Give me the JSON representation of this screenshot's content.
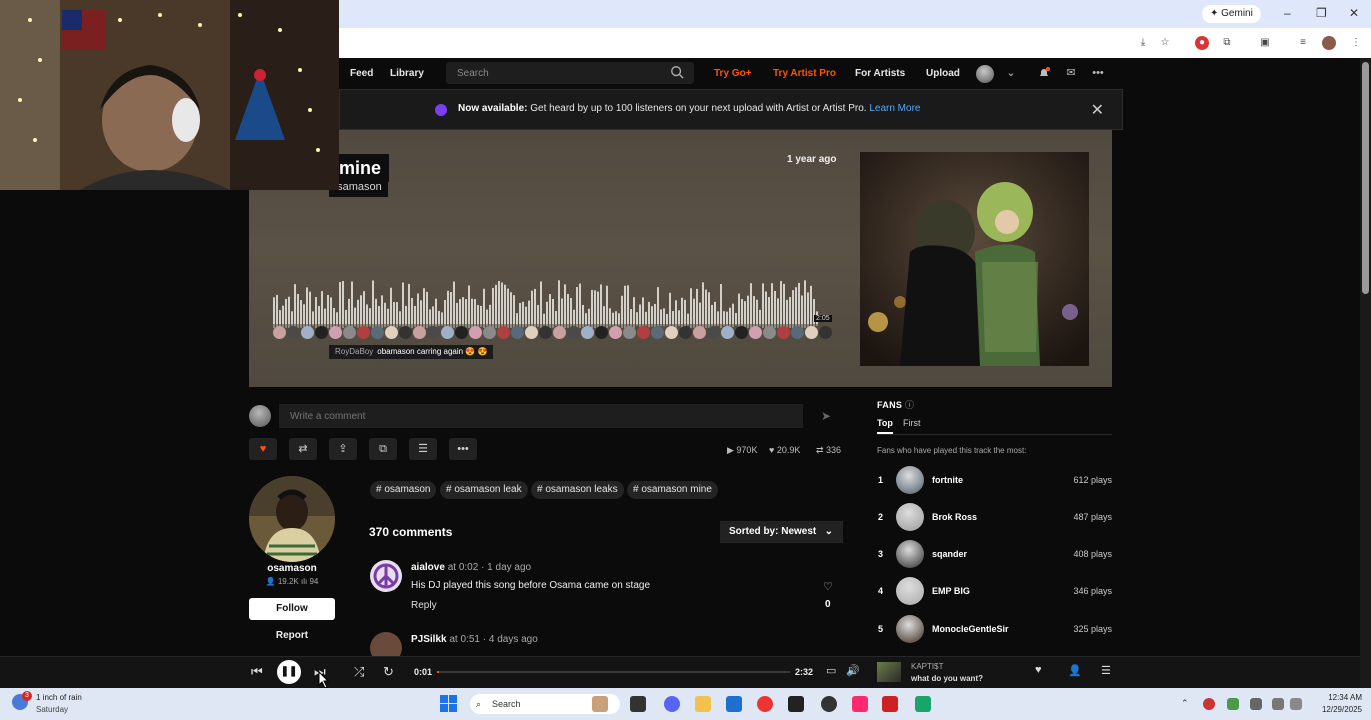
{
  "browser": {
    "gemini_label": "✦ Gemini",
    "controls": [
      "–",
      "❐",
      "✕"
    ]
  },
  "nav": {
    "feed": "Feed",
    "library": "Library",
    "search_placeholder": "Search",
    "try_go": "Try Go+",
    "try_artist_pro": "Try Artist Pro",
    "for_artists": "For Artists",
    "upload": "Upload"
  },
  "banner": {
    "bold": "Now available:",
    "text": " Get heard by up to 100 listeners on your next upload with Artist or Artist Pro. ",
    "link": "Learn More"
  },
  "track": {
    "title": "mine",
    "artist": "osamason",
    "age": "1 year ago",
    "wave_time": "2:05",
    "wave_comment_user": "RoyDaBoy",
    "wave_comment_text": "obamason carring again 😍 😍",
    "waveform_progress": 0.0
  },
  "comment_box": {
    "placeholder": "Write a comment"
  },
  "stats": {
    "plays": "970K",
    "likes": "20.9K",
    "reposts": "336"
  },
  "artist": {
    "name": "osamason",
    "followers": "19.2K",
    "tracks": "94",
    "follow": "Follow",
    "report": "Report"
  },
  "tags": [
    "# osamason",
    "# osamason leak",
    "# osamason leaks",
    "# osamason mine"
  ],
  "comments_section": {
    "count": "370 comments",
    "sort": "Sorted by: Newest",
    "items": [
      {
        "user": "aialove",
        "at": " at ",
        "time": "0:02",
        "age": " · 1 day ago",
        "text": "His DJ played this song before Osama came on stage",
        "reply": "Reply",
        "likes": "0"
      },
      {
        "user": "PJSilkk",
        "at": " at ",
        "time": "0:51",
        "age": " · 4 days ago",
        "text": "",
        "reply": "Reply",
        "likes": ""
      }
    ]
  },
  "fans": {
    "title": "FANS",
    "tab_top": "Top",
    "tab_first": "First",
    "subtitle": "Fans who have played this track the most:",
    "list": [
      {
        "rank": "1",
        "name": "fortnite",
        "plays": "612 plays"
      },
      {
        "rank": "2",
        "name": "Brok Ross",
        "plays": "487 plays"
      },
      {
        "rank": "3",
        "name": "sqander",
        "plays": "408 plays"
      },
      {
        "rank": "4",
        "name": "EMP BIG",
        "plays": "346 plays"
      },
      {
        "rank": "5",
        "name": "MonocleGentleSir",
        "plays": "325 plays"
      }
    ]
  },
  "player": {
    "current": "0:01",
    "total": "2:32",
    "progress": 0.007,
    "np_artist": "KAPTI$T",
    "np_title": "what do you want?"
  },
  "taskbar": {
    "weather": "1 inch of rain",
    "weather_day": "Saturday",
    "weather_badge": "3",
    "search": "Search",
    "time": "12:34 AM",
    "date": "12/29/2025"
  }
}
